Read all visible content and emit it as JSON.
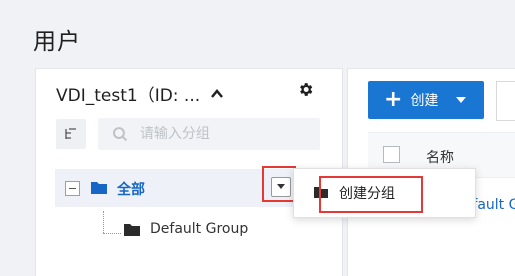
{
  "page": {
    "title": "用户"
  },
  "left_panel": {
    "dept_name": "VDI_test1（ID: ...",
    "search": {
      "placeholder": "请输入分组",
      "value": ""
    },
    "tree": {
      "root_label": "全部",
      "children": [
        {
          "label": "Default Group"
        }
      ]
    }
  },
  "right_panel": {
    "create_button_label": "创建",
    "table": {
      "columns": [
        "名称"
      ],
      "rows": [
        {
          "name": "Default G"
        }
      ]
    }
  },
  "dropdown": {
    "items": [
      {
        "label": "创建分组"
      }
    ]
  },
  "colors": {
    "accent": "#1976d2",
    "link": "#1766c6",
    "highlight_border": "#e53935",
    "selected_row_bg": "#eef2f8"
  }
}
